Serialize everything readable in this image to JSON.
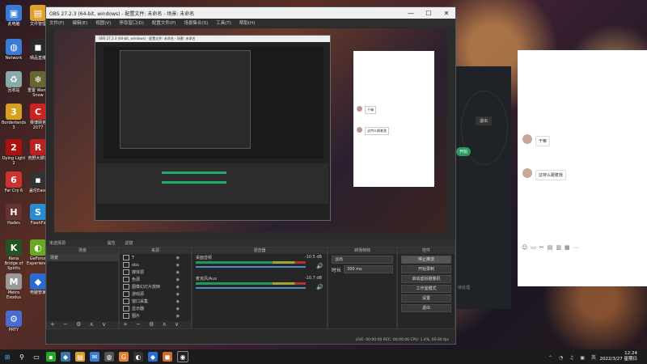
{
  "desktop": {
    "icons": [
      {
        "label": "此电脑",
        "color": "#3a7bd5",
        "glyph": "▣"
      },
      {
        "label": "文件管理",
        "color": "#e0a030",
        "glyph": "▤"
      },
      {
        "label": "Network",
        "color": "#3a7bd5",
        "glyph": "◍"
      },
      {
        "label": "晴品直播",
        "color": "#2a2a2a",
        "glyph": "◼"
      },
      {
        "label": "回收站",
        "color": "#8aa",
        "glyph": "♻"
      },
      {
        "label": "重置 Warm Snow",
        "color": "#663",
        "glyph": "❄"
      },
      {
        "label": "Borderlands 3",
        "color": "#d8a020",
        "glyph": "3"
      },
      {
        "label": "赛博朋克 2077",
        "color": "#c22",
        "glyph": "C"
      },
      {
        "label": "Dying Light 2",
        "color": "#a11",
        "glyph": "2"
      },
      {
        "label": "荒野大镖客",
        "color": "#b22",
        "glyph": "R"
      },
      {
        "label": "Far Cry 6",
        "color": "#c33",
        "glyph": "6"
      },
      {
        "label": "盖伦Ease",
        "color": "#333",
        "glyph": "▪"
      },
      {
        "label": "Hades",
        "color": "#633",
        "glyph": "H"
      },
      {
        "label": "FlashFx",
        "color": "#2a8cd0",
        "glyph": "S"
      },
      {
        "label": "Kena Bridge of Spirits",
        "color": "#252",
        "glyph": "K"
      },
      {
        "label": "GeForce Experience",
        "color": "#6a2",
        "glyph": "◐"
      },
      {
        "label": "Metro Exodus",
        "color": "#999",
        "glyph": "M"
      },
      {
        "label": "电脑管家",
        "color": "#2a6bd0",
        "glyph": "◆"
      },
      {
        "label": "PRTY",
        "color": "#4a6bd0",
        "glyph": "⚙"
      }
    ]
  },
  "obs": {
    "title": "OBS 27.2.3 (64-bit, windows) - 配置文件: 未命名 - 场景: 未命名",
    "menu": [
      "文件(F)",
      "编辑(E)",
      "视图(V)",
      "停靠窗口(D)",
      "配置文件(P)",
      "场景集合(S)",
      "工具(T)",
      "帮助(H)"
    ],
    "dock_header": {
      "no_source": "未选择源",
      "properties": "属性",
      "filters": "滤镜"
    },
    "panels": {
      "scenes": {
        "title": "场景",
        "items": [
          "场景"
        ]
      },
      "sources": {
        "title": "来源",
        "items": [
          "T",
          "obs",
          "媒体源",
          "色源",
          "图像幻灯片放映",
          "游戏源",
          "窗口采集",
          "显示器",
          "图片",
          "显示器采集",
          "文字",
          "音源"
        ]
      },
      "mixer": {
        "title": "混音器",
        "tracks": [
          {
            "name": "桌面音频",
            "db": "-10.5 dB",
            "level": 0.72
          },
          {
            "name": "麦克风/Aux",
            "db": "-10.7 dB",
            "level": 0.6
          }
        ]
      },
      "transitions": {
        "title": "转场特效",
        "type": "淡出",
        "duration_label": "时长",
        "duration": "300 ms"
      },
      "controls": {
        "title": "控件",
        "buttons": [
          "停止推流",
          "开始录制",
          "启动虚拟摄像机",
          "工作室模式",
          "设置",
          "退出"
        ]
      }
    },
    "status": "LIVE: 00:00:00   REC: 00:00:00   CPU: 1.4%, 60.00 fps",
    "footer_controls": "+ − ⚙ ∧ ∨"
  },
  "preview_chat": {
    "messages": [
      "干嘛",
      "这特么跟着我"
    ]
  },
  "chat_dark": {
    "button": "退出",
    "badge": "开始",
    "label": "待处理"
  },
  "chat_white": {
    "messages": [
      "干嘛",
      "这特么跟着我"
    ]
  },
  "taskbar": {
    "time": "12:24",
    "date": "2022/3/27 星期日"
  }
}
